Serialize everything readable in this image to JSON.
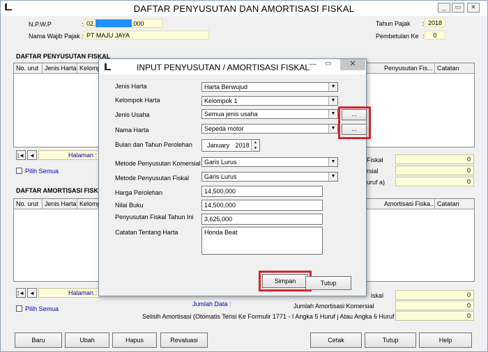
{
  "window": {
    "title": "DAFTAR PENYUSUTAN DAN AMORTISASI FISKAL"
  },
  "header": {
    "npwp_label": "N.P.W.P",
    "npwp_value_prefix": "02.",
    "npwp_value_suffix": ".000",
    "nama_label": "Nama Wajib Pajak",
    "nama_value": "PT MAJU JAYA",
    "tahun_label": "Tahun Pajak",
    "tahun_value": "2018",
    "pembetulan_label": "Pembetulan Ke",
    "pembetulan_value": "0",
    "colon": ":"
  },
  "penyusutan": {
    "title": "DAFTAR PENYUSUTAN FISKAL",
    "columns_left": [
      "No. urut",
      "Jenis Harta",
      "Kelomp"
    ],
    "columns_right": [
      "Penyusutan Fis...",
      "Catatan"
    ],
    "halaman_label": "Halaman :",
    "pilih_semua": "Pilih Semua",
    "sum_labels": [
      "Fiskal",
      "rsial",
      "uruf a)"
    ],
    "sum_values": [
      "0",
      "0",
      "0"
    ]
  },
  "amortisasi": {
    "title": "DAFTAR AMORTISASI FISKA",
    "columns_left": [
      "No. urut",
      "Jenis Harta",
      "Kelomp"
    ],
    "columns_right": [
      "Amortisasi Fiska...",
      "Catatan"
    ],
    "halaman_label": "Halaman :",
    "pilih_semua": "Pilih Semua",
    "jumlah_data_label": "Jumlah Data :",
    "sum_labels": [
      "iskal",
      "Jumlah Amortisasi Komersial",
      "Selisih Amortisasi (Otomatis Terisi Ke Formulir 1771 - I Angka 5 Huruf j Atau Angka 6 Huruf b)"
    ],
    "sum_values": [
      "0",
      "0",
      "0"
    ]
  },
  "nav": {
    "first": "|◄",
    "prev": "◄"
  },
  "bottom_buttons": [
    "Baru",
    "Ubah",
    "Hapus",
    "Revaluasi",
    "Cetak",
    "Tutup",
    "Help"
  ],
  "dialog": {
    "title": "INPUT PENYUSUTAN / AMORTISASI FISKAL",
    "close": "✕",
    "fields": {
      "jenis_harta_label": "Jenis Harta",
      "jenis_harta_value": "Harta Berwujud",
      "kelompok_label": "Kelompok Harta",
      "kelompok_value": "Kelompok 1",
      "jenis_usaha_label": "Jenis Usaha",
      "jenis_usaha_value": "Semua jenis usaha",
      "nama_harta_label": "Nama Harta",
      "nama_harta_value": "Sepeda motor",
      "bulan_label": "Bulan dan Tahun Perolehan",
      "bulan_value": "January",
      "tahun_value": "2018",
      "metode_komersial_label": "Metode Penyusutan Komersial",
      "metode_komersial_value": "Garis Lurus",
      "metode_fiskal_label": "Metode Penyusutan Fiskal",
      "metode_fiskal_value": "Garis Lurus",
      "harga_label": "Harga Perolehan",
      "harga_value": "14,500,000",
      "nilai_buku_label": "Nilai Buku",
      "nilai_buku_value": "14,500,000",
      "penyusutan_label": "Penyusutan Fiskal Tahun Ini",
      "penyusutan_value": "3,625,000",
      "catatan_label": "Catatan Tentang Harta",
      "catatan_value": "Honda Beat"
    },
    "ellipsis": "...",
    "simpan": "Simpan",
    "tutup": "Tutup"
  },
  "colors": {
    "highlight": "#d8232a",
    "field_yellow": "#fffcd8",
    "blue_mask": "#1e90ff"
  }
}
